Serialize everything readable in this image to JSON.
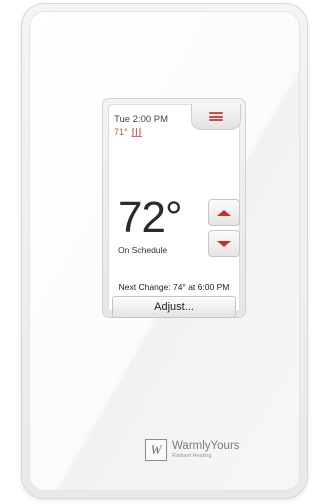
{
  "status": {
    "datetime": "Tue 2:00 PM",
    "floor_temp": "71°",
    "heating_icon": "heat-waves-icon"
  },
  "menu": {
    "icon": "hamburger-menu-icon"
  },
  "setpoint": {
    "value": "72°",
    "mode": "On Schedule",
    "up_icon": "arrow-up-icon",
    "down_icon": "arrow-down-icon"
  },
  "schedule": {
    "next_change": "Next Change:  74° at 6:00 PM"
  },
  "actions": {
    "adjust_label": "Adjust..."
  },
  "brand": {
    "logo": "W",
    "name": "WarmlyYours",
    "tagline": "Radiant Heating"
  },
  "colors": {
    "accent": "#d24b3e",
    "arrow": "#c9302c",
    "text": "#2b2b2b"
  }
}
